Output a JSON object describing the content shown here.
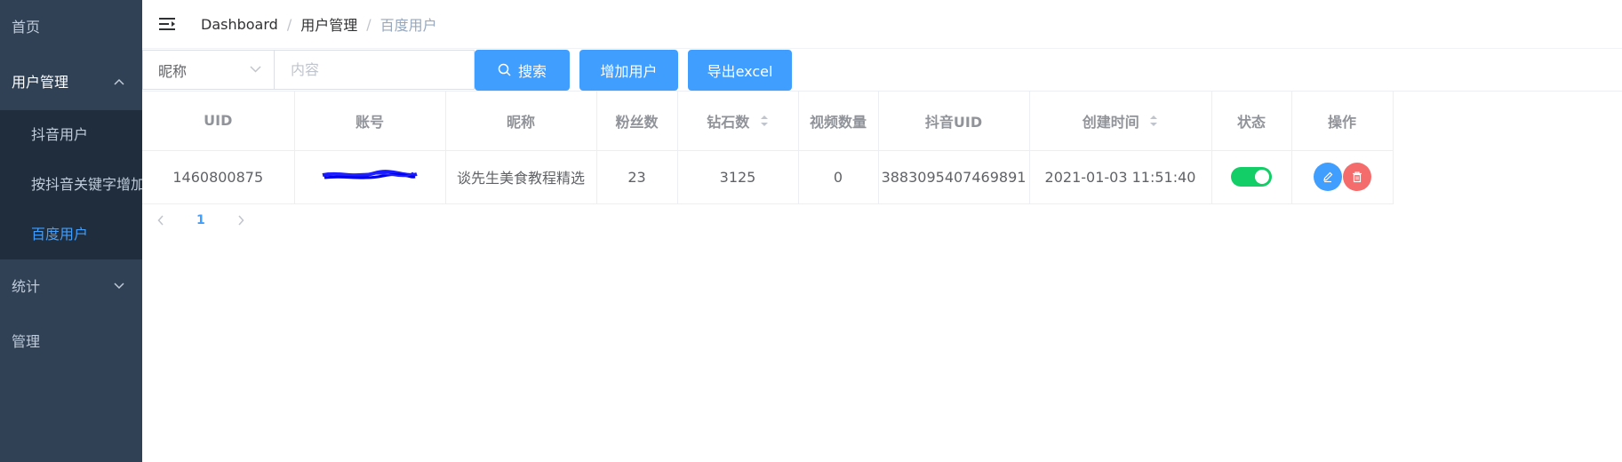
{
  "sidebar": {
    "items": [
      {
        "label": "首页"
      },
      {
        "label": "用户管理",
        "children": [
          "抖音用户",
          "按抖音关键字增加",
          "百度用户"
        ]
      },
      {
        "label": "统计"
      },
      {
        "label": "管理"
      }
    ],
    "active_child": "百度用户"
  },
  "breadcrumb": [
    "Dashboard",
    "用户管理",
    "百度用户"
  ],
  "filter": {
    "select_value": "昵称",
    "input_placeholder": "内容",
    "search_label": "搜索",
    "add_label": "增加用户",
    "export_label": "导出excel"
  },
  "table": {
    "columns": [
      "UID",
      "账号",
      "昵称",
      "粉丝数",
      "钻石数",
      "视频数量",
      "抖音UID",
      "创建时间",
      "状态",
      "操作"
    ],
    "rows": [
      {
        "uid": "1460800875",
        "account": "",
        "nickname": "谈先生美食教程精选",
        "fans": "23",
        "diamonds": "3125",
        "videos": "0",
        "douyin_uid": "3883095407469891",
        "created": "2021-01-03 11:51:40",
        "status_on": true
      }
    ]
  },
  "pagination": {
    "current": "1"
  },
  "colors": {
    "sidebar_bg": "#304156",
    "submenu_bg": "#1f2d3d",
    "primary": "#409eff",
    "danger": "#f56c6c",
    "success": "#13ce66"
  }
}
